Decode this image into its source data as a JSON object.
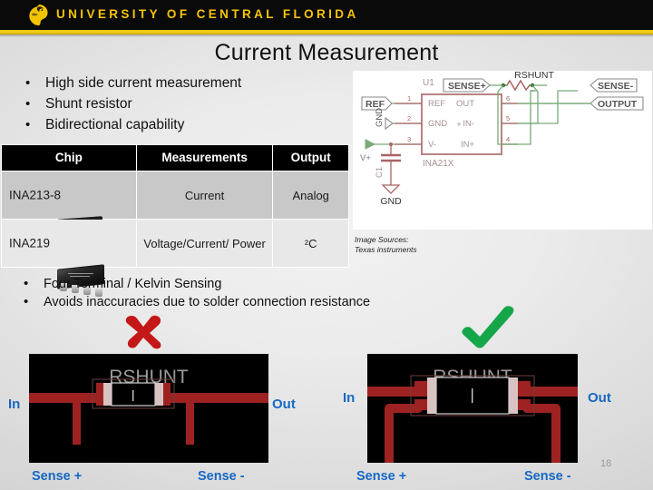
{
  "header": {
    "institution": "UNIVERSITY OF CENTRAL FLORIDA",
    "logo_name": "ucf-pegasus-logo",
    "bar_color": "#f3d21a",
    "bg_color": "#0a0a0a"
  },
  "slide": {
    "title": "Current Measurement",
    "page_number": "18"
  },
  "bullets_top": [
    {
      "dot": "•",
      "text": "High side current measurement"
    },
    {
      "dot": "•",
      "text": "Shunt resistor"
    },
    {
      "dot": "•",
      "text": "Bidirectional capability"
    }
  ],
  "table": {
    "headers": [
      "Chip",
      "Measurements",
      "Output"
    ],
    "rows": [
      {
        "chip": "INA213-8",
        "chip_photo": "sot23-6-ic-photo",
        "measurements": "Current",
        "output": "Analog"
      },
      {
        "chip": "INA219",
        "chip_photo": "soic-8-ic-photo",
        "measurements": "Voltage/Current/ Power",
        "output": "²C"
      }
    ]
  },
  "schematic": {
    "name": "ina21x-current-sense-schematic",
    "ref_designator": "U1",
    "part_number": "INA21X",
    "pins_left": [
      {
        "num": "1",
        "name": "REF"
      },
      {
        "num": "2",
        "name": "GND"
      },
      {
        "num": "3",
        "name": "V-"
      }
    ],
    "pins_right": [
      {
        "num": "6",
        "name": "OUT"
      },
      {
        "num": "5",
        "name": "IN-"
      },
      {
        "num": "4",
        "name": "IN+"
      }
    ],
    "plus_symbol": "+",
    "nets": {
      "ref": "REF",
      "gnd_left": "GND",
      "vplus": "V+",
      "cap": "C1",
      "gnd_bottom": "GND",
      "sense_plus": "SENSE+",
      "sense_minus": "SENSE-",
      "rshunt": "RSHUNT",
      "output": "OUTPUT"
    },
    "wire_color": "#7aaa7a",
    "symbol_color": "#a86464"
  },
  "image_source": {
    "line1": "Image Sources:",
    "line2": "Texas instruments"
  },
  "bullets_bottom": [
    {
      "dot": "•",
      "text": "Four Terminal / Kelvin Sensing"
    },
    {
      "dot": "•",
      "text": "Avoids inaccuracies due to solder connection resistance"
    }
  ],
  "verdicts": {
    "bad": {
      "name": "red-x-mark",
      "glyph": "✖",
      "color": "#c41818"
    },
    "good": {
      "name": "green-check-mark",
      "glyph": "✔",
      "color": "#16a64a"
    }
  },
  "pcb_left": {
    "name": "two-terminal-shunt-layout",
    "part_label": "RSHUNT",
    "in": "In",
    "out": "Out",
    "sense_plus": "Sense +",
    "sense_minus": "Sense -",
    "trace_color": "#9e2222",
    "pad_color": "#d8c2c2",
    "board_color": "#000000",
    "label_color": "#1668c4"
  },
  "pcb_right": {
    "name": "four-terminal-kelvin-shunt-layout",
    "part_label": "RSHUNT",
    "in": "In",
    "out": "Out",
    "sense_plus": "Sense +",
    "sense_minus": "Sense -",
    "trace_color": "#9e2222",
    "pad_color": "#d8c2c2",
    "board_color": "#000000",
    "label_color": "#1668c4"
  }
}
